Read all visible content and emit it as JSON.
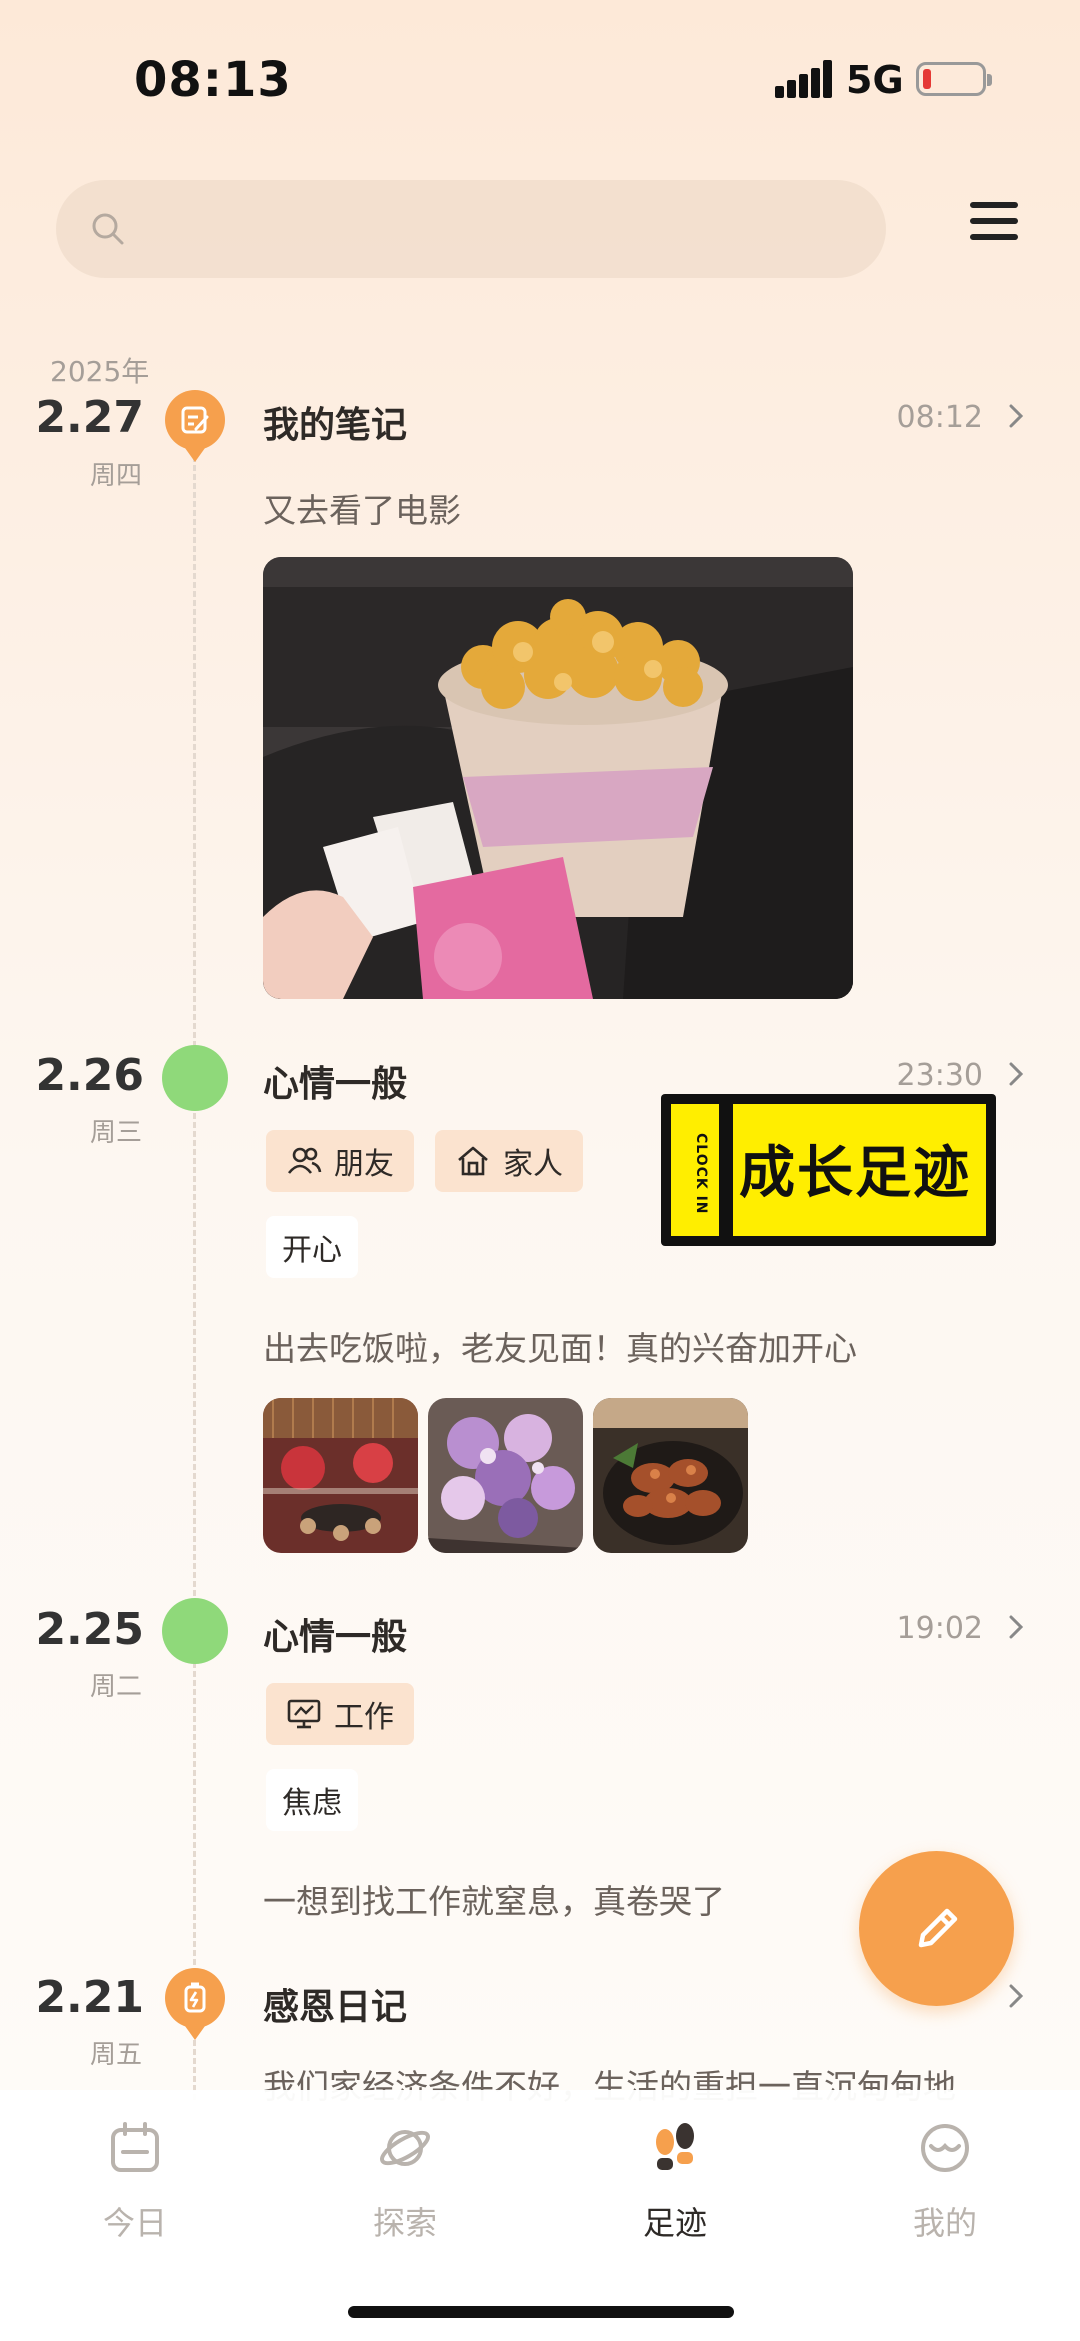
{
  "status_bar": {
    "time": "08:13",
    "network": "5G"
  },
  "search": {
    "placeholder": ""
  },
  "year": "2025年",
  "entries": [
    {
      "date": "2.27",
      "weekday": "周四",
      "title": "我的笔记",
      "time": "08:12",
      "text": "又去看了电影",
      "icon": "note-icon"
    },
    {
      "date": "2.26",
      "weekday": "周三",
      "title": "心情一般",
      "time": "23:30",
      "tags": [
        "朋友",
        "家人"
      ],
      "mood": "开心",
      "text": "出去吃饭啦，老友见面！真的兴奋加开心"
    },
    {
      "date": "2.25",
      "weekday": "周二",
      "title": "心情一般",
      "time": "19:02",
      "tags": [
        "工作"
      ],
      "mood": "焦虑",
      "text": "一想到找工作就窒息，真卷哭了"
    },
    {
      "date": "2.21",
      "weekday": "周五",
      "title": "感恩日记",
      "time": "",
      "text": "我们家经济条件不好，生活的重担一直沉甸甸地",
      "icon": "gratitude-icon"
    }
  ],
  "badge": {
    "title": "成长足迹",
    "vertical": "CLOCK IN"
  },
  "nav": [
    {
      "label": "今日",
      "icon": "calendar-icon"
    },
    {
      "label": "探索",
      "icon": "planet-icon"
    },
    {
      "label": "足迹",
      "icon": "footprints-icon",
      "active": true
    },
    {
      "label": "我的",
      "icon": "smiley-icon"
    }
  ],
  "colors": {
    "accent": "#f6a04d",
    "mood_green": "#8fd97a",
    "tag_bg": "#fbe3cf",
    "badge_yellow": "#ffee00"
  }
}
